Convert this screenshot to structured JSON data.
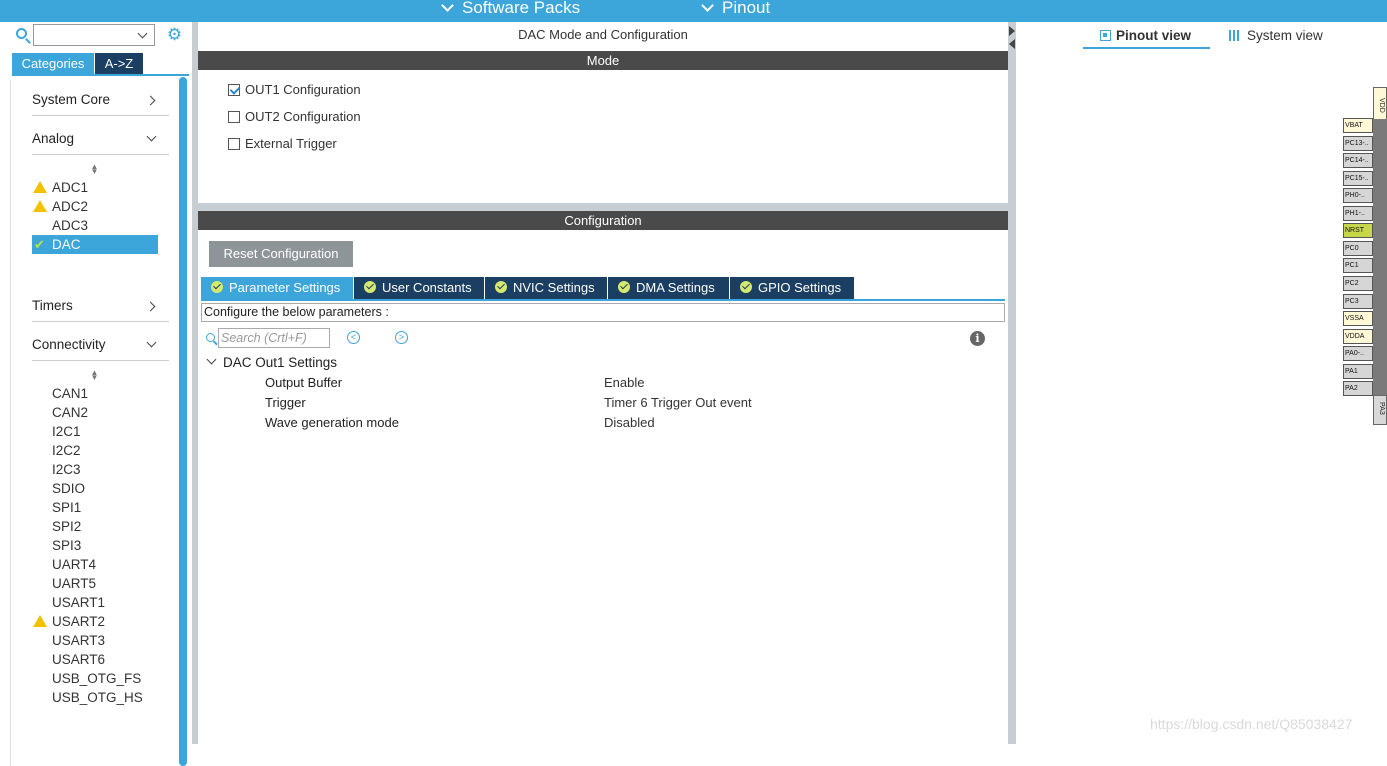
{
  "topbar": {
    "software_packs": "Software Packs",
    "pinout": "Pinout"
  },
  "left": {
    "tabs": {
      "categories": "Categories",
      "az": "A->Z"
    },
    "categories": {
      "system_core": "System Core",
      "analog": "Analog",
      "timers": "Timers",
      "connectivity": "Connectivity"
    },
    "analog_items": [
      "ADC1",
      "ADC2",
      "ADC3",
      "DAC"
    ],
    "connectivity_items": [
      "CAN1",
      "CAN2",
      "I2C1",
      "I2C2",
      "I2C3",
      "SDIO",
      "SPI1",
      "SPI2",
      "SPI3",
      "UART4",
      "UART5",
      "USART1",
      "USART2",
      "USART3",
      "USART6",
      "USB_OTG_FS",
      "USB_OTG_HS"
    ],
    "icons": {
      "search": "search-icon",
      "gear": "gear-icon",
      "warning": "warning-icon",
      "check": "check-icon"
    }
  },
  "middle": {
    "title": "DAC Mode and Configuration",
    "mode_header": "Mode",
    "mode_options": [
      {
        "label": "OUT1 Configuration",
        "checked": true
      },
      {
        "label": "OUT2 Configuration",
        "checked": false
      },
      {
        "label": "External Trigger",
        "checked": false
      }
    ],
    "config_header": "Configuration",
    "reset_button": "Reset Configuration",
    "tabs": [
      "Parameter Settings",
      "User Constants",
      "NVIC Settings",
      "DMA Settings",
      "GPIO Settings"
    ],
    "active_tab": "Parameter Settings",
    "configure_text": "Configure the below parameters :",
    "search_placeholder": "Search (Crtl+F)",
    "group_label": "DAC Out1 Settings",
    "params": [
      {
        "name": "Output Buffer",
        "value": "Enable"
      },
      {
        "name": "Trigger",
        "value": "Timer 6 Trigger Out event"
      },
      {
        "name": "Wave generation mode",
        "value": "Disabled"
      }
    ]
  },
  "right": {
    "pinout_view": "Pinout view",
    "system_view": "System view",
    "top_pin": "VDD",
    "bottom_pin": "PA3",
    "pins": [
      "VBAT",
      "PC13-..",
      "PC14-..",
      "PC15-..",
      "PH0-..",
      "PH1-..",
      "NRST",
      "PC0",
      "PC1",
      "PC2",
      "PC3",
      "VSSA",
      "VDDA",
      "PA0-..",
      "PA1",
      "PA2"
    ]
  },
  "watermark": "https://blog.csdn.net/Q85038427",
  "colors": {
    "accent": "#3ca5d9",
    "dark_tab": "#1b3e63",
    "header": "#4a4a4a",
    "warning": "#f2c200"
  }
}
